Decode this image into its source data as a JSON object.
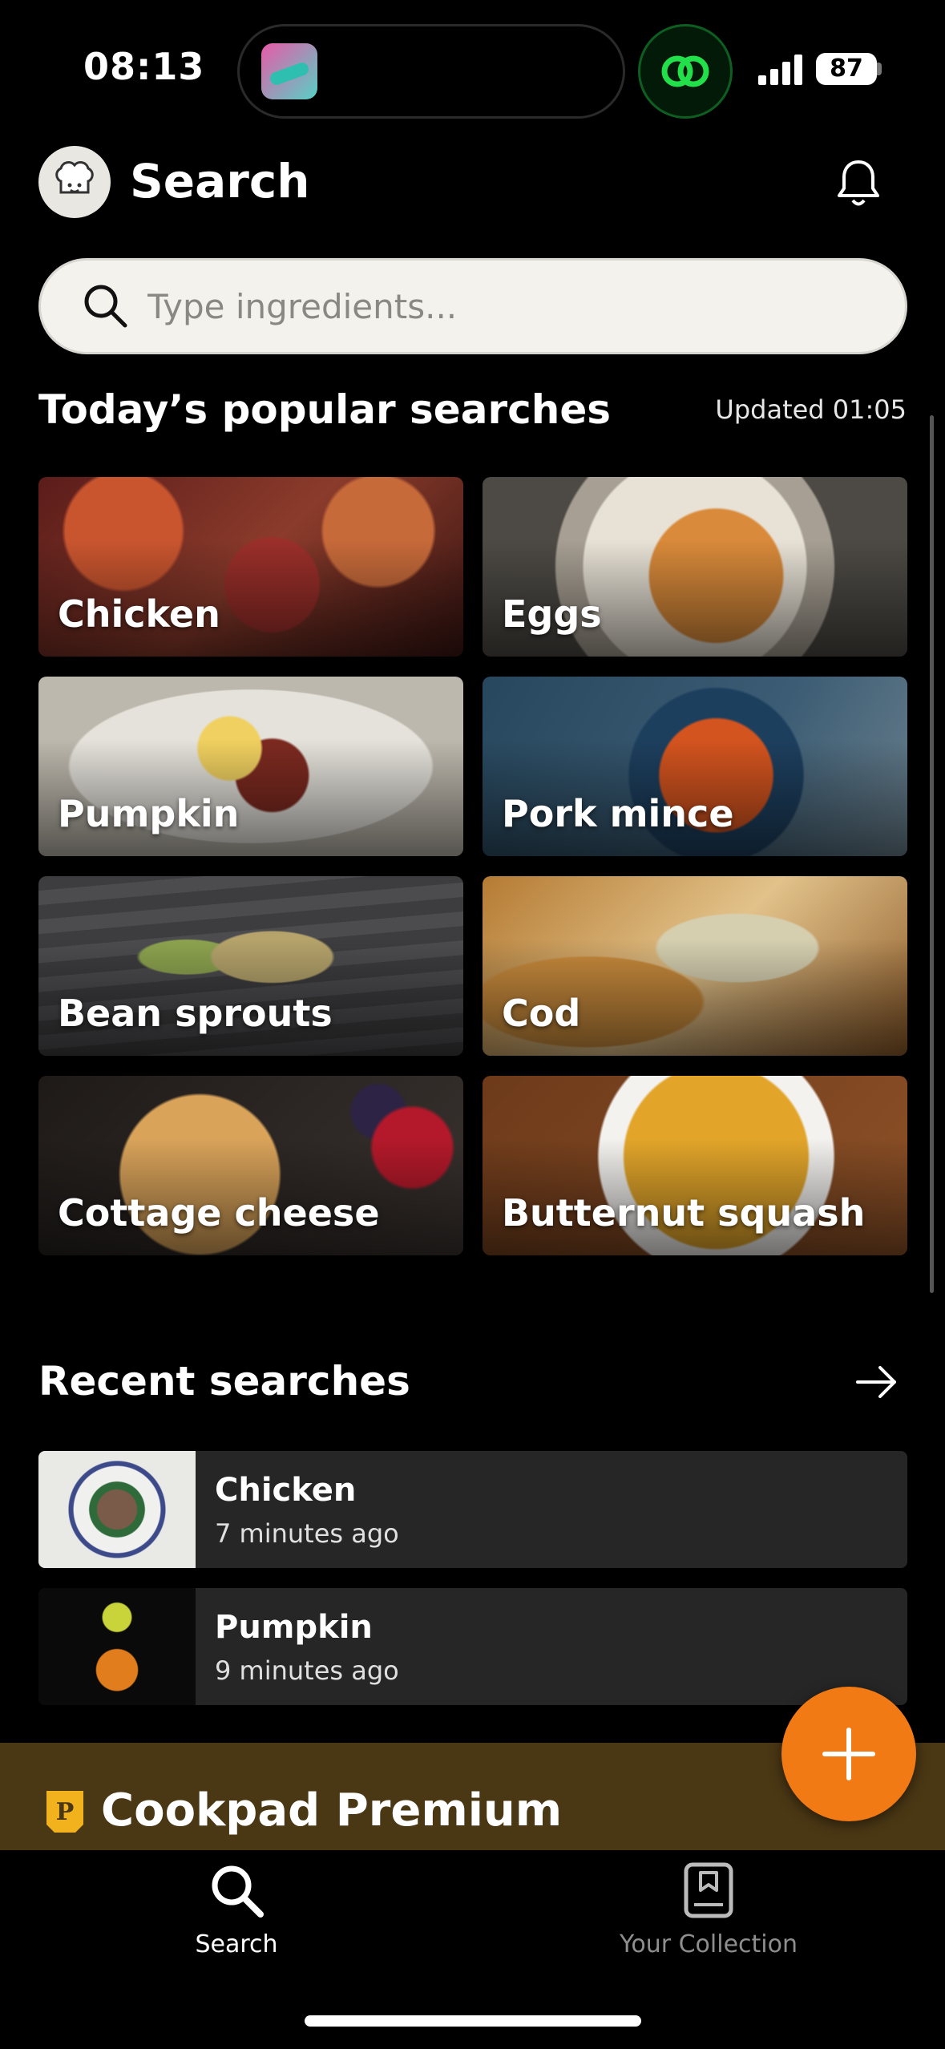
{
  "status_bar": {
    "time": "08:13",
    "battery": "87"
  },
  "header": {
    "title": "Search"
  },
  "search": {
    "placeholder": "Type ingredients..."
  },
  "popular": {
    "title": "Today’s popular searches",
    "updated": "Updated 01:05",
    "items": [
      {
        "label": "Chicken"
      },
      {
        "label": "Eggs"
      },
      {
        "label": "Pumpkin"
      },
      {
        "label": "Pork mince"
      },
      {
        "label": "Bean sprouts"
      },
      {
        "label": "Cod"
      },
      {
        "label": "Cottage cheese"
      },
      {
        "label": "Butternut squash"
      }
    ]
  },
  "recent": {
    "title": "Recent searches",
    "items": [
      {
        "name": "Chicken",
        "time": "7 minutes ago"
      },
      {
        "name": "Pumpkin",
        "time": "9 minutes ago"
      }
    ]
  },
  "premium": {
    "label": "Cookpad Premium"
  },
  "tabs": [
    {
      "label": "Search",
      "icon": "search-icon",
      "active": true
    },
    {
      "label": "Your Collection",
      "icon": "collection-icon",
      "active": false
    }
  ],
  "colors": {
    "accent": "#f27a14",
    "premium_bg": "#4a3714",
    "card_bg": "#262626"
  }
}
